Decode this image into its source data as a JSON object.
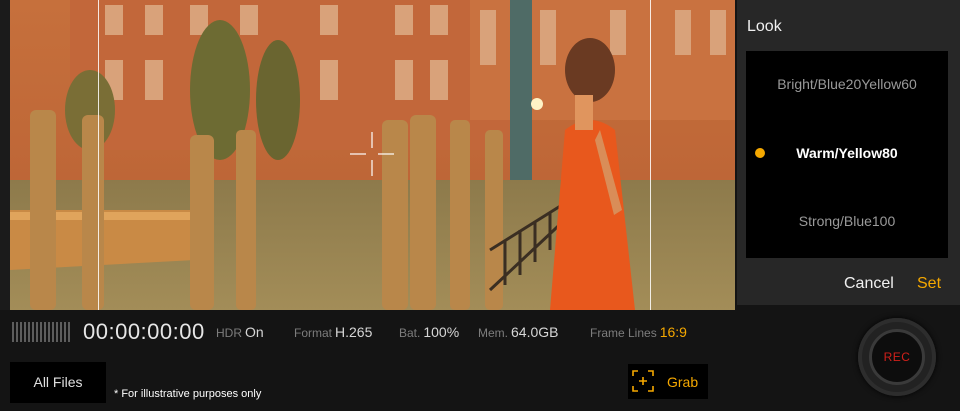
{
  "look_panel": {
    "title": "Look",
    "items": [
      {
        "label": "Bright/Blue20Yellow60"
      },
      {
        "label": "Warm/Yellow80"
      },
      {
        "label": "Strong/Blue100"
      }
    ],
    "selected_index": 1,
    "cancel_label": "Cancel",
    "set_label": "Set"
  },
  "status": {
    "timecode": "00:00:00:00",
    "hdr": {
      "label": "HDR",
      "value": "On"
    },
    "format": {
      "label": "Format",
      "value": "H.265"
    },
    "battery": {
      "label": "Bat.",
      "value": "100%"
    },
    "memory": {
      "label": "Mem.",
      "value": "64.0GB"
    },
    "frame_lines": {
      "label": "Frame Lines",
      "value": "16:9"
    }
  },
  "controls": {
    "all_files_label": "All Files",
    "disclaimer": "* For illustrative purposes only",
    "grab_label": "Grab",
    "rec_label": "REC"
  },
  "colors": {
    "accent": "#f5a800",
    "rec": "#d0201a"
  },
  "icons": {
    "grab": "grab-frame-icon",
    "focus": "focus-crosshair-icon",
    "meter": "audio-level-meter-icon"
  }
}
